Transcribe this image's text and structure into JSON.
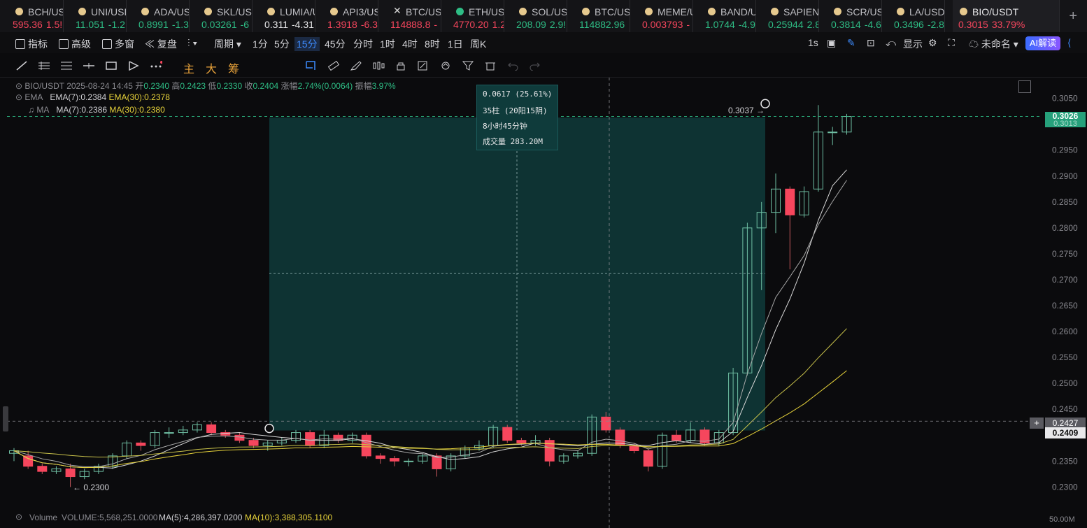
{
  "tabs": [
    {
      "symbol": "BCH/USI",
      "price": "595.36",
      "change": "1.5!",
      "dir": "dn"
    },
    {
      "symbol": "UNI/USD",
      "price": "11.051",
      "change": "-1.2",
      "dir": "up"
    },
    {
      "symbol": "ADA/USI",
      "price": "0.8991",
      "change": "-1.3",
      "dir": "up"
    },
    {
      "symbol": "SKL/USD",
      "price": "0.03261",
      "change": "-6",
      "dir": "up"
    },
    {
      "symbol": "LUMIA/U",
      "price": "0.311",
      "change": "-4.31",
      "dir": "nu"
    },
    {
      "symbol": "API3/USI",
      "price": "1.3918",
      "change": "-6.3",
      "dir": "dn"
    },
    {
      "symbol": "BTC/USD",
      "price": "114888.8",
      "change": "-",
      "dir": "dn",
      "icon": "x"
    },
    {
      "symbol": "ETH/USD",
      "price": "4770.20",
      "change": "1.2",
      "dir": "dn",
      "icon": "s"
    },
    {
      "symbol": "SOL/USD",
      "price": "208.09",
      "change": "2.9!",
      "dir": "up"
    },
    {
      "symbol": "BTC/USD",
      "price": "114882.96",
      "change": "",
      "dir": "up"
    },
    {
      "symbol": "MEME/U",
      "price": "0.003793",
      "change": "-",
      "dir": "dn"
    },
    {
      "symbol": "BAND/U",
      "price": "1.0744",
      "change": "-4.9",
      "dir": "up"
    },
    {
      "symbol": "SAPIEN/",
      "price": "0.25944",
      "change": "2.8",
      "dir": "up"
    },
    {
      "symbol": "SCR/USD",
      "price": "0.3814",
      "change": "-4.6",
      "dir": "up"
    },
    {
      "symbol": "LA/USDT",
      "price": "0.3496",
      "change": "-2.8",
      "dir": "up"
    },
    {
      "symbol": "BIO/USDT",
      "price": "0.3015",
      "change": "33.79%",
      "dir": "dn",
      "active": true
    }
  ],
  "toolbar": {
    "indicators": "指标",
    "advanced": "高级",
    "multiwin": "多窗",
    "replay": "复盘",
    "period": "周期",
    "intervals": [
      "1分",
      "5分",
      "15分",
      "45分",
      "分时",
      "1时",
      "4时",
      "8时",
      "1日",
      "周K"
    ],
    "selected_interval": "15分",
    "sec": "1s",
    "display": "显示",
    "layout_name": "未命名",
    "ai": "AI解读"
  },
  "drawing_tools_cn": [
    "主",
    "大",
    "筹"
  ],
  "legend": {
    "symbol": "BIO/USDT",
    "datetime": "2025-08-24 14:45",
    "open_label": "开",
    "open": "0.2340",
    "high_label": "高",
    "high": "0.2423",
    "low_label": "低",
    "low": "0.2330",
    "close_label": "收",
    "close": "0.2404",
    "chg_label": "涨幅",
    "chg": "2.74%(0.0064)",
    "amp_label": "振幅",
    "amp": "3.97%",
    "ema_label": "EMA",
    "ema7": "EMA(7):0.2384",
    "ema30": "EMA(30):0.2378",
    "ma_label": "MA",
    "ma7": "MA(7):0.2386",
    "ma30": "MA(30):0.2380"
  },
  "measure": {
    "change": "0.0617 (25.61%)",
    "bars": "35柱 (20阳15阴)",
    "duration": "8小时45分钟",
    "volume": "成交量 283.20M"
  },
  "annotations": {
    "high": "0.3037",
    "low": "0.2300"
  },
  "price_tags": {
    "last": "0.3026",
    "cross": "0.2427",
    "level": "0.2409",
    "hidden": "0.3013"
  },
  "volume": {
    "label": "Volume",
    "vol": "VOLUME:5,568,251.0000",
    "ma5": "MA(5):4,286,397.0200",
    "ma10": "MA(10):3,388,305.1100",
    "axis_tick": "50.00M"
  },
  "colors": {
    "up": "#2ebd85",
    "down": "#f6465d",
    "ema7": "#d8d8d8",
    "ma30": "#e6d23a",
    "measure_fill": "#0f3b3b"
  },
  "chart_data": {
    "type": "candlestick",
    "ylim": [
      0.226,
      0.309
    ],
    "y_ticks": [
      "0.3050",
      "0.3000",
      "0.2950",
      "0.2900",
      "0.2850",
      "0.2800",
      "0.2750",
      "0.2700",
      "0.2650",
      "0.2600",
      "0.2550",
      "0.2500",
      "0.2450",
      "0.2400",
      "0.2350",
      "0.2300"
    ],
    "candles": [
      [
        0.2365,
        0.237,
        0.235,
        0.2375
      ],
      [
        0.236,
        0.234,
        0.2335,
        0.237
      ],
      [
        0.234,
        0.233,
        0.2325,
        0.2345
      ],
      [
        0.233,
        0.2335,
        0.2325,
        0.234
      ],
      [
        0.2335,
        0.232,
        0.23,
        0.2345
      ],
      [
        0.232,
        0.233,
        0.2315,
        0.2335
      ],
      [
        0.233,
        0.234,
        0.2325,
        0.2345
      ],
      [
        0.234,
        0.236,
        0.2335,
        0.2365
      ],
      [
        0.236,
        0.2385,
        0.2355,
        0.239
      ],
      [
        0.2385,
        0.238,
        0.237,
        0.239
      ],
      [
        0.238,
        0.2405,
        0.2375,
        0.241
      ],
      [
        0.2405,
        0.2405,
        0.2395,
        0.2415
      ],
      [
        0.2405,
        0.241,
        0.24,
        0.2418
      ],
      [
        0.241,
        0.242,
        0.2405,
        0.2425
      ],
      [
        0.242,
        0.2405,
        0.24,
        0.2425
      ],
      [
        0.2405,
        0.24,
        0.2395,
        0.241
      ],
      [
        0.24,
        0.239,
        0.2385,
        0.2405
      ],
      [
        0.239,
        0.238,
        0.2375,
        0.2395
      ],
      [
        0.238,
        0.2385,
        0.237,
        0.239
      ],
      [
        0.2385,
        0.239,
        0.238,
        0.2395
      ],
      [
        0.239,
        0.2405,
        0.2385,
        0.241
      ],
      [
        0.2405,
        0.238,
        0.2375,
        0.241
      ],
      [
        0.238,
        0.24,
        0.2375,
        0.241
      ],
      [
        0.24,
        0.239,
        0.2385,
        0.2405
      ],
      [
        0.239,
        0.24,
        0.2385,
        0.2405
      ],
      [
        0.24,
        0.236,
        0.2355,
        0.2405
      ],
      [
        0.236,
        0.2355,
        0.2345,
        0.2365
      ],
      [
        0.2355,
        0.235,
        0.234,
        0.236
      ],
      [
        0.235,
        0.235,
        0.234,
        0.2355
      ],
      [
        0.235,
        0.236,
        0.2345,
        0.2365
      ],
      [
        0.236,
        0.2335,
        0.232,
        0.2365
      ],
      [
        0.2335,
        0.236,
        0.233,
        0.2365
      ],
      [
        0.236,
        0.2375,
        0.2355,
        0.238
      ],
      [
        0.2375,
        0.238,
        0.237,
        0.239
      ],
      [
        0.238,
        0.2415,
        0.2375,
        0.242
      ],
      [
        0.2415,
        0.239,
        0.2385,
        0.242
      ],
      [
        0.239,
        0.2385,
        0.238,
        0.2395
      ],
      [
        0.2385,
        0.239,
        0.238,
        0.24
      ],
      [
        0.239,
        0.235,
        0.234,
        0.2395
      ],
      [
        0.235,
        0.236,
        0.2345,
        0.2365
      ],
      [
        0.236,
        0.2365,
        0.2355,
        0.237
      ],
      [
        0.2365,
        0.2435,
        0.236,
        0.244
      ],
      [
        0.2435,
        0.241,
        0.2405,
        0.2445
      ],
      [
        0.241,
        0.238,
        0.2375,
        0.2415
      ],
      [
        0.238,
        0.237,
        0.2365,
        0.2385
      ],
      [
        0.237,
        0.234,
        0.233,
        0.2375
      ],
      [
        0.234,
        0.24,
        0.2335,
        0.2405
      ],
      [
        0.24,
        0.239,
        0.2385,
        0.241
      ],
      [
        0.239,
        0.241,
        0.2385,
        0.2425
      ],
      [
        0.241,
        0.2385,
        0.238,
        0.2415
      ],
      [
        0.2385,
        0.2405,
        0.238,
        0.241
      ],
      [
        0.2405,
        0.252,
        0.24,
        0.253
      ],
      [
        0.252,
        0.28,
        0.2515,
        0.281
      ],
      [
        0.28,
        0.283,
        0.268,
        0.285
      ],
      [
        0.283,
        0.2875,
        0.279,
        0.2905
      ],
      [
        0.2875,
        0.2825,
        0.272,
        0.288
      ],
      [
        0.2825,
        0.287,
        0.282,
        0.288
      ],
      [
        0.2875,
        0.2985,
        0.287,
        0.3037
      ],
      [
        0.2985,
        0.2985,
        0.296,
        0.2995
      ],
      [
        0.2985,
        0.3015,
        0.298,
        0.302
      ]
    ]
  }
}
